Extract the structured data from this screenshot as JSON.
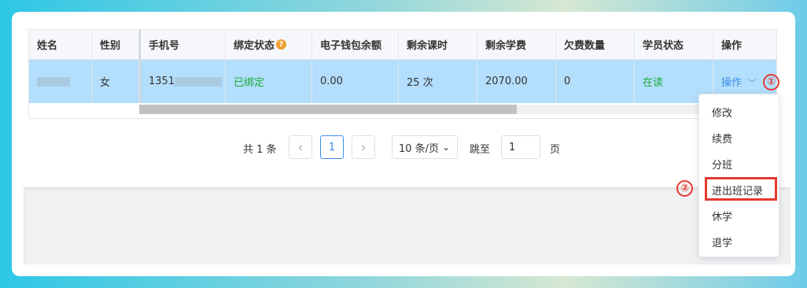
{
  "table": {
    "headers": [
      "姓名",
      "性别",
      "手机号",
      "绑定状态",
      "电子钱包余额",
      "剩余课时",
      "剩余学费",
      "欠费数量",
      "学员状态",
      "操作"
    ],
    "binding_help_icon": "?",
    "row": {
      "name_masked": "",
      "gender": "女",
      "phone_prefix": "1351",
      "binding_status": "已绑定",
      "wallet_balance": "0.00",
      "remaining_hours": "25 次",
      "remaining_tuition": "2070.00",
      "arrears_count": "0",
      "student_status": "在读",
      "action_label": "操作",
      "action_chevron": "﹀"
    }
  },
  "pagination": {
    "total_text": "共 1 条",
    "prev_icon": "‹",
    "current_page": "1",
    "next_icon": "›",
    "page_size": "10 条/页",
    "page_size_chevron": "⌄",
    "goto_label": "跳至",
    "goto_value": "1",
    "page_unit": "页"
  },
  "dropdown": {
    "items": [
      "修改",
      "续费",
      "分班",
      "进出班记录",
      "休学",
      "退学"
    ],
    "highlighted": "进出班记录"
  },
  "annotations": [
    "①",
    "②"
  ],
  "colors": {
    "accent": "#3a8ee6",
    "row_highlight": "#b3defc",
    "status_green": "#1aad3b",
    "annotation_red": "#e5392f"
  }
}
